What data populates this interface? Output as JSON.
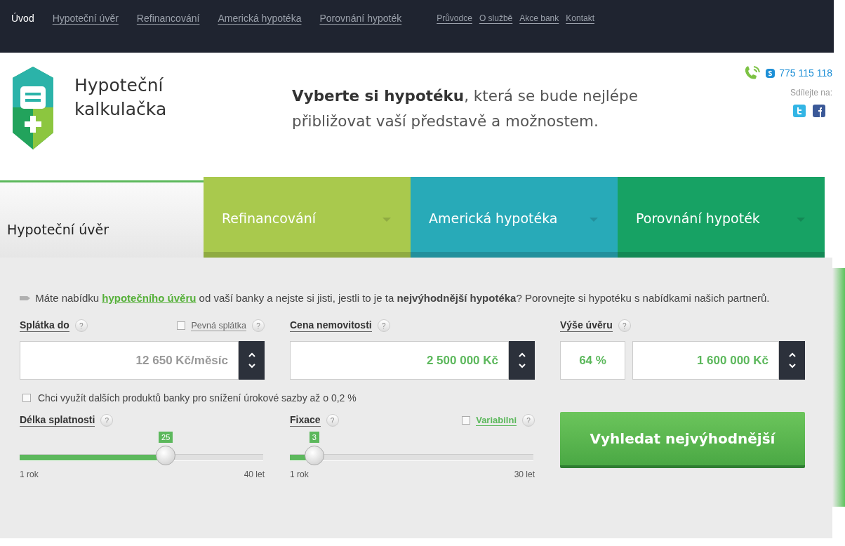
{
  "nav": {
    "main": [
      {
        "label": "Úvod",
        "selected": true
      },
      {
        "label": "Hypoteční úvěr",
        "selected": false
      },
      {
        "label": "Refinancování",
        "selected": false
      },
      {
        "label": "Americká hypotéka",
        "selected": false
      },
      {
        "label": "Porovnání hypoték",
        "selected": false
      }
    ],
    "secondary": [
      {
        "label": "Průvodce",
        "selected": false
      },
      {
        "label": "O službě",
        "selected": false
      },
      {
        "label": "Akce bank",
        "selected": false
      },
      {
        "label": "Kontakt",
        "selected": false
      }
    ]
  },
  "logo": {
    "title": [
      "Hypoteční",
      "kalkulačka"
    ]
  },
  "tagline": "**Vyberte si hypotéku**, která se bude nejlépe přibližovat vaší představě a možnostem.",
  "contact": {
    "phone": "775 115 118",
    "share_label": "Sdílejte na:"
  },
  "tabs": [
    {
      "label": "Hypoteční úvěr",
      "selected": true
    },
    {
      "label": "Refinancování",
      "selected": false,
      "color": "#a9c94d"
    },
    {
      "label": "Americká hypotéka",
      "selected": false,
      "color": "#28aab8"
    },
    {
      "label": "Porovnání hypoték",
      "selected": false,
      "color": "#17a264"
    }
  ],
  "intro": {
    "before": "Máte nabídku",
    "link": "hypotečního úvěru",
    "after": "od vaší banky a nejste si jisti, jestli to je ta **nejvýhodnější hypotéka**? Porovnejte si hypotéku s nabídkami našich partnerů."
  },
  "fields": {
    "payment": {
      "label": "Splátka do",
      "help": "?",
      "fixed": {
        "label": "Pevná splátka",
        "help": "?",
        "checked": false
      },
      "placeholder": "12 650 Kč/měsíc"
    },
    "price": {
      "label": "Cena nemovitosti",
      "help": "?",
      "value": "2 500 000 Kč"
    },
    "loan": {
      "label": "Výše úvěru",
      "help": "?",
      "percent": "64 %",
      "value": "1 600 000 Kč"
    }
  },
  "extra": {
    "label": "Chci využít dalších produktů banky pro snížení úrokové sazby až o 0,2 %",
    "checked": false
  },
  "sliders": [
    {
      "label": "Délka splatnosti",
      "help": "?",
      "value": "25",
      "level": 0.6,
      "min": "1 rok",
      "max": "40 let"
    },
    {
      "label": "Fixace",
      "help": "?",
      "value": "3",
      "level": 0.1,
      "min": "1 rok",
      "max": "30 let",
      "variable": {
        "label": "Variabilni",
        "help": "?",
        "checked": false
      }
    }
  ],
  "search_button": "Vyhledat nejvýhodnější"
}
